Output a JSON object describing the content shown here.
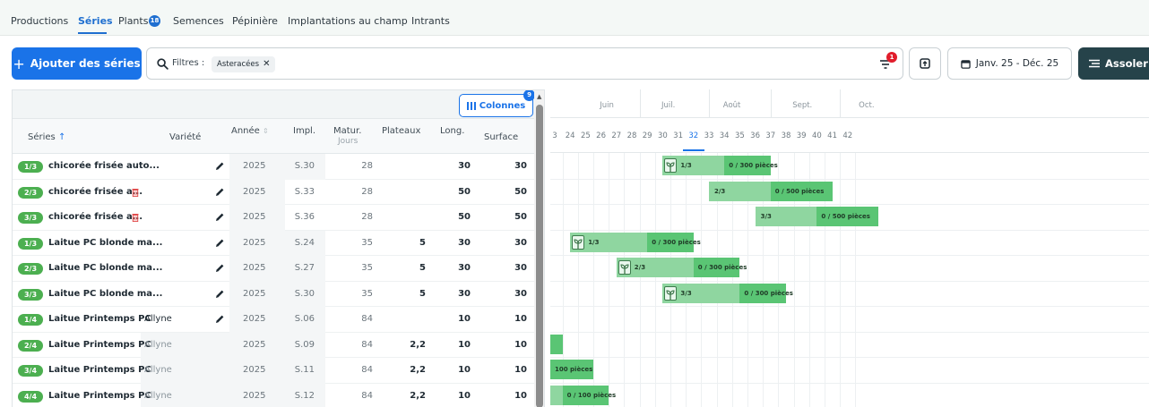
{
  "nav": {
    "tabs": [
      {
        "label": "Productions"
      },
      {
        "label": "Séries"
      },
      {
        "label": "Plants"
      },
      {
        "label": "Semences"
      },
      {
        "label": "Pépinière"
      },
      {
        "label": "Implantations au champ"
      },
      {
        "label": "Intrants"
      }
    ],
    "plants_badge": "18"
  },
  "toolbar": {
    "add_label": "Ajouter des séries",
    "filter_label": "Filtres :",
    "chip_label": "Asteracées",
    "filter_badge": "1",
    "date_label": "Janv. 25 - Déc. 25",
    "assoler_label": "Assoler ("
  },
  "table": {
    "columns_button": "Colonnes",
    "columns_badge": "9",
    "headers": {
      "series": "Séries",
      "variety": "Variété",
      "year": "Année",
      "impl": "Impl.",
      "matur": "Matur.",
      "matur_sub": "Jours",
      "plateaux": "Plateaux",
      "long": "Long.",
      "surface": "Surface"
    },
    "rows": [
      {
        "pill": "1/3",
        "name": "chicorée frisée auto...",
        "trash": false,
        "variety": "",
        "variety_grey": false,
        "pencil": true,
        "year": "2025",
        "impl": "S.30",
        "matur": "28",
        "plateaux": "",
        "long": "30",
        "surface": "30"
      },
      {
        "pill": "2/3",
        "name": "chicorée frisée a...",
        "trash": true,
        "variety": "",
        "variety_grey": false,
        "pencil": true,
        "year": "2025",
        "impl": "S.33",
        "matur": "28",
        "plateaux": "",
        "long": "50",
        "surface": "50"
      },
      {
        "pill": "3/3",
        "name": "chicorée frisée a...",
        "trash": true,
        "variety": "",
        "variety_grey": false,
        "pencil": true,
        "year": "2025",
        "impl": "S.36",
        "matur": "28",
        "plateaux": "",
        "long": "50",
        "surface": "50"
      },
      {
        "pill": "1/3",
        "name": "Laitue PC blonde ma...",
        "trash": false,
        "variety": "",
        "variety_grey": false,
        "pencil": true,
        "year": "2025",
        "impl": "S.24",
        "matur": "35",
        "plateaux": "5",
        "long": "30",
        "surface": "30"
      },
      {
        "pill": "2/3",
        "name": "Laitue PC blonde ma...",
        "trash": false,
        "variety": "",
        "variety_grey": false,
        "pencil": true,
        "year": "2025",
        "impl": "S.27",
        "matur": "35",
        "plateaux": "5",
        "long": "30",
        "surface": "30"
      },
      {
        "pill": "3/3",
        "name": "Laitue PC blonde ma...",
        "trash": false,
        "variety": "",
        "variety_grey": false,
        "pencil": true,
        "year": "2025",
        "impl": "S.30",
        "matur": "35",
        "plateaux": "5",
        "long": "30",
        "surface": "30"
      },
      {
        "pill": "1/4",
        "name": "Laitue Printemps PC",
        "trash": false,
        "variety": "Allyne",
        "variety_grey": false,
        "pencil": true,
        "year": "2025",
        "impl": "S.06",
        "matur": "84",
        "plateaux": "",
        "long": "10",
        "surface": "10"
      },
      {
        "pill": "2/4",
        "name": "Laitue Printemps PC",
        "trash": false,
        "variety": "Allyne",
        "variety_grey": true,
        "pencil": false,
        "year": "2025",
        "impl": "S.09",
        "matur": "84",
        "plateaux": "2,2",
        "long": "10",
        "surface": "10"
      },
      {
        "pill": "3/4",
        "name": "Laitue Printemps PC",
        "trash": false,
        "variety": "Allyne",
        "variety_grey": true,
        "pencil": false,
        "year": "2025",
        "impl": "S.11",
        "matur": "84",
        "plateaux": "2,2",
        "long": "10",
        "surface": "10"
      },
      {
        "pill": "4/4",
        "name": "Laitue Printemps PC",
        "trash": false,
        "variety": "Allyne",
        "variety_grey": true,
        "pencil": false,
        "year": "2025",
        "impl": "S.12",
        "matur": "84",
        "plateaux": "2,2",
        "long": "10",
        "surface": "10"
      }
    ]
  },
  "gantt": {
    "months": [
      "Juin",
      "Juil.",
      "Août",
      "Sept.",
      "Oct."
    ],
    "weeks": [
      "3",
      "24",
      "25",
      "26",
      "27",
      "28",
      "29",
      "30",
      "31",
      "32",
      "33",
      "34",
      "35",
      "36",
      "37",
      "38",
      "39",
      "40",
      "41",
      "42"
    ],
    "current_week": "32",
    "bars": [
      {
        "row": 0,
        "start_week": 30,
        "end_week": 37,
        "dark_from_week": 34,
        "plant_icon": true,
        "label": "1/3",
        "progress_label": "0 / 300 pièces"
      },
      {
        "row": 1,
        "start_week": 33,
        "end_week": 41,
        "dark_from_week": 37,
        "plant_icon": false,
        "label": "2/3",
        "progress_label": "0 / 500 pièces"
      },
      {
        "row": 2,
        "start_week": 36,
        "end_week": 44,
        "dark_from_week": 40,
        "plant_icon": false,
        "label": "3/3",
        "progress_label": "0 / 500 pièces"
      },
      {
        "row": 3,
        "start_week": 24,
        "end_week": 32,
        "dark_from_week": 29,
        "plant_icon": true,
        "label": "1/3",
        "progress_label": "0 / 300 pièces"
      },
      {
        "row": 4,
        "start_week": 27,
        "end_week": 35,
        "dark_from_week": 32,
        "plant_icon": true,
        "label": "2/3",
        "progress_label": "0 / 300 pièces"
      },
      {
        "row": 5,
        "start_week": 30,
        "end_week": 38,
        "dark_from_week": 35,
        "plant_icon": true,
        "label": "3/3",
        "progress_label": "0 / 300 pièces"
      },
      {
        "row": 7,
        "start_week": 22,
        "end_week": 23.5,
        "dark_from_week": 22,
        "plant_icon": false,
        "label": "",
        "progress_label": ""
      },
      {
        "row": 8,
        "start_week": 22,
        "end_week": 25.5,
        "dark_from_week": 22,
        "plant_icon": false,
        "label": "",
        "progress_label": "100 pièces"
      },
      {
        "row": 9,
        "start_week": 22,
        "end_week": 26.5,
        "dark_from_week": 23.5,
        "plant_icon": false,
        "label": "",
        "progress_label": "0 / 100 pièces"
      }
    ]
  },
  "colors": {
    "primary": "#1a73e8",
    "dark_button": "#26434a",
    "pill_green": "#4caf50",
    "bar_light": "#8fd6a0",
    "bar_dark": "#5ac574",
    "alert_red": "#e11d2b"
  }
}
